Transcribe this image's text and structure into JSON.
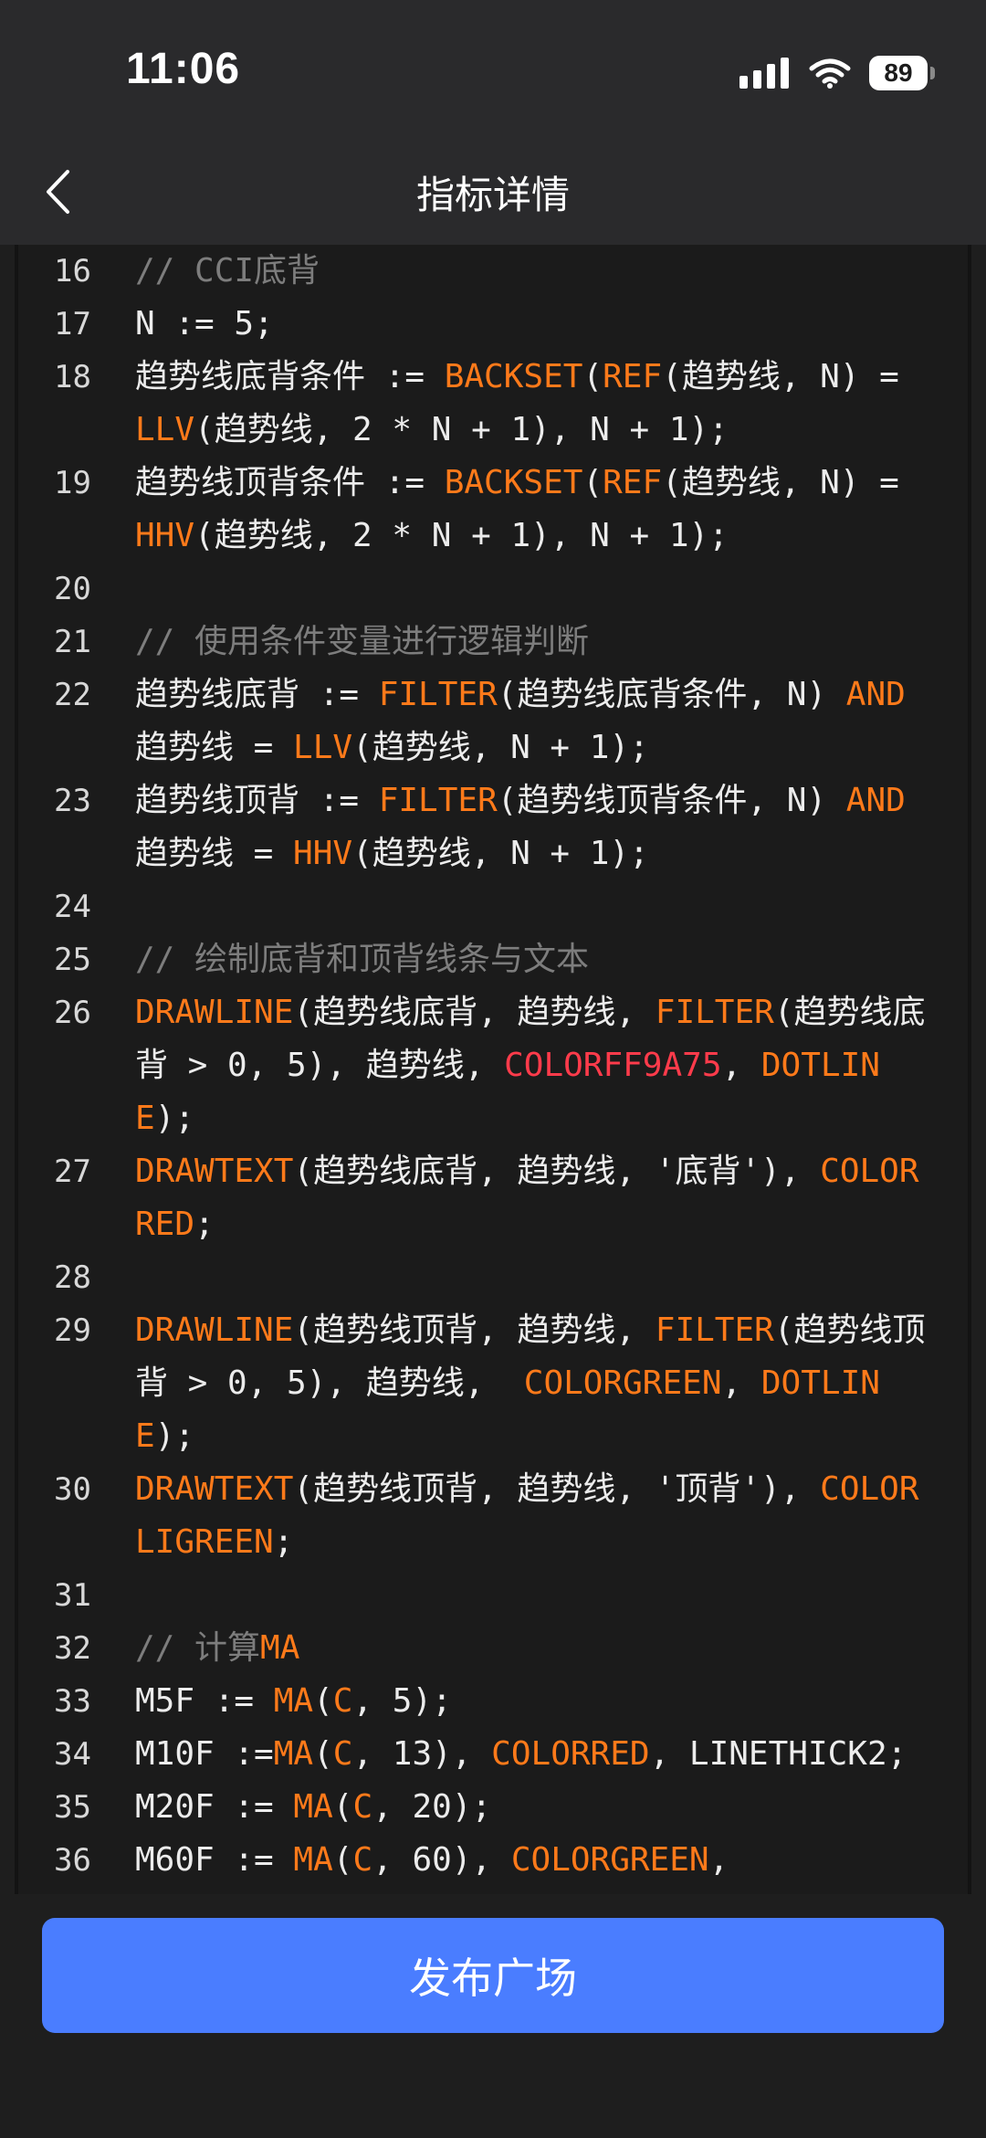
{
  "status_bar": {
    "time": "11:06",
    "battery": "89"
  },
  "header": {
    "title": "指标详情"
  },
  "code_lines": [
    {
      "n": "16",
      "t": "// CCI底背"
    },
    {
      "n": "17",
      "t": "N := 5;"
    },
    {
      "n": "18",
      "t": "趋势线底背条件 := BACKSET(REF(趋势线, N) = LLV(趋势线, 2 * N + 1), N + 1);"
    },
    {
      "n": "19",
      "t": "趋势线顶背条件 := BACKSET(REF(趋势线, N) = HHV(趋势线, 2 * N + 1), N + 1);"
    },
    {
      "n": "20",
      "t": ""
    },
    {
      "n": "21",
      "t": "// 使用条件变量进行逻辑判断"
    },
    {
      "n": "22",
      "t": "趋势线底背 := FILTER(趋势线底背条件, N) AND 趋势线 = LLV(趋势线, N + 1);"
    },
    {
      "n": "23",
      "t": "趋势线顶背 := FILTER(趋势线顶背条件, N) AND 趋势线 = HHV(趋势线, N + 1);"
    },
    {
      "n": "24",
      "t": ""
    },
    {
      "n": "25",
      "t": "// 绘制底背和顶背线条与文本"
    },
    {
      "n": "26",
      "t": "DRAWLINE(趋势线底背, 趋势线, FILTER(趋势线底背 > 0, 5), 趋势线, COLORFF9A75, DOTLINE);"
    },
    {
      "n": "27",
      "t": "DRAWTEXT(趋势线底背, 趋势线, '底背'), COLORRED;"
    },
    {
      "n": "28",
      "t": ""
    },
    {
      "n": "29",
      "t": "DRAWLINE(趋势线顶背, 趋势线, FILTER(趋势线顶背 > 0, 5), 趋势线,  COLORGREEN, DOTLINE);"
    },
    {
      "n": "30",
      "t": "DRAWTEXT(趋势线顶背, 趋势线, '顶背'), COLORLIGREEN;"
    },
    {
      "n": "31",
      "t": ""
    },
    {
      "n": "32",
      "t": "// 计算MA"
    },
    {
      "n": "33",
      "t": "M5F := MA(C, 5);"
    },
    {
      "n": "34",
      "t": "M10F :=MA(C, 13), COLORRED, LINETHICK2;"
    },
    {
      "n": "35",
      "t": "M20F := MA(C, 20);"
    },
    {
      "n": "36",
      "t": "M60F := MA(C, 60), COLORGREEN,"
    }
  ],
  "keywords": [
    "BACKSET",
    "REF",
    "LLV",
    "HHV",
    "FILTER",
    "AND",
    "DRAWLINE",
    "DRAWTEXT",
    "DOTLINE",
    "COLORRED",
    "COLORGREEN",
    "COLORLIGREEN",
    "MA",
    "C"
  ],
  "special_colors": {
    "COLORFF9A75": "#ff3b4b"
  },
  "colors": {
    "keyword": "#ff7a1a",
    "comment": "#7d7d7d",
    "accent_button": "#4a7dff"
  },
  "footer": {
    "publish_label": "发布广场"
  }
}
